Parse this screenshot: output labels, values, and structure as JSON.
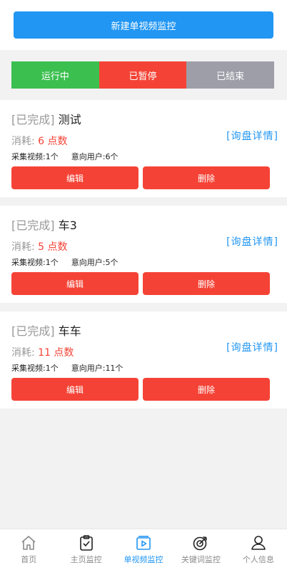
{
  "header": {
    "new_button_label": "新建单视频监控"
  },
  "filter_tabs": [
    {
      "label": "运行中",
      "color": "#3bbf4f"
    },
    {
      "label": "已暂停",
      "color": "#f44336"
    },
    {
      "label": "已结束",
      "color": "#9e9ea8"
    }
  ],
  "tasks": [
    {
      "status": "[已完成]",
      "name": "测试",
      "cost_label": "消耗:",
      "cost_value": "6 点数",
      "detail_link": "[询盘详情]",
      "videos_label": "采集视频:",
      "videos_value": "1个",
      "users_label": "意向用户:",
      "users_value": "6个",
      "edit_label": "编辑",
      "delete_label": "删除"
    },
    {
      "status": "[已完成]",
      "name": "车3",
      "cost_label": "消耗:",
      "cost_value": "5 点数",
      "detail_link": "[询盘详情]",
      "videos_label": "采集视频:",
      "videos_value": "1个",
      "users_label": "意向用户:",
      "users_value": "5个",
      "edit_label": "编辑",
      "delete_label": "删除"
    },
    {
      "status": "[已完成]",
      "name": "车车",
      "cost_label": "消耗:",
      "cost_value": "11 点数",
      "detail_link": "[询盘详情]",
      "videos_label": "采集视频:",
      "videos_value": "1个",
      "users_label": "意向用户:",
      "users_value": "11个",
      "edit_label": "编辑",
      "delete_label": "删除"
    }
  ],
  "bottom_nav": [
    {
      "label": "首页",
      "icon": "home-icon",
      "active": false
    },
    {
      "label": "主页监控",
      "icon": "clipboard-check-icon",
      "active": false
    },
    {
      "label": "单视频监控",
      "icon": "video-play-icon",
      "active": true
    },
    {
      "label": "关键词监控",
      "icon": "target-icon",
      "active": false
    },
    {
      "label": "个人信息",
      "icon": "user-icon",
      "active": false
    }
  ],
  "colors": {
    "primary": "#2196f3",
    "danger": "#f44336",
    "success": "#3bbf4f",
    "muted": "#9e9ea8"
  }
}
